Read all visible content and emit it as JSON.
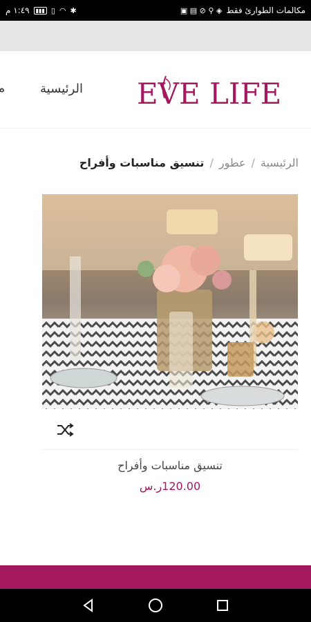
{
  "status_bar": {
    "time": "١:٤٩ م",
    "carrier_text": "مكالمات الطوارئ فقط",
    "battery_label": "▭"
  },
  "header": {
    "logo_text": "EVE LIFE",
    "nav": {
      "home": "الرئيسية",
      "more": "م"
    }
  },
  "breadcrumb": {
    "items": [
      "الرئيسية",
      "عطور"
    ],
    "separator": "/",
    "current": "تنسيق مناسبات وأفراح"
  },
  "product": {
    "title": "تنسيق مناسبات وأفراح",
    "price": "120.00ر.س"
  },
  "colors": {
    "brand": "#a3185f",
    "text": "#333333",
    "muted": "#888888"
  },
  "icons": {
    "compare": "shuffle-icon",
    "back": "back-triangle-icon",
    "home": "home-circle-icon",
    "recents": "recents-square-icon"
  }
}
